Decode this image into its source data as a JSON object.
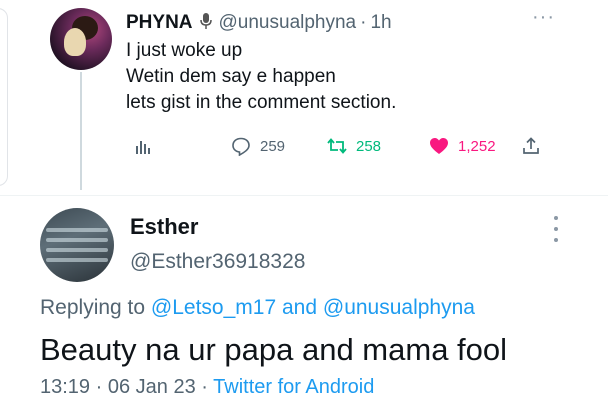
{
  "parent": {
    "name": "PHYNA",
    "handle": "@unusualphyna",
    "separator": "·",
    "time": "1h",
    "lines": [
      "I just woke up",
      "Wetin dem say e happen",
      "lets gist in the comment section."
    ],
    "replies": "259",
    "retweets": "258",
    "likes": "1,252",
    "colors": {
      "retweet": "#00ba7c",
      "like": "#f91880"
    }
  },
  "reply": {
    "name": "Esther",
    "handle": "@Esther36918328",
    "replying_prefix": "Replying to",
    "mention1": "@Letso_m17",
    "replying_and": "and",
    "mention2": "@unusualphyna",
    "text": "Beauty na ur papa and mama fool",
    "time": "13:19",
    "separator": "·",
    "date": "06 Jan 23",
    "source": "Twitter for Android",
    "accent": "#1d9bf0"
  }
}
